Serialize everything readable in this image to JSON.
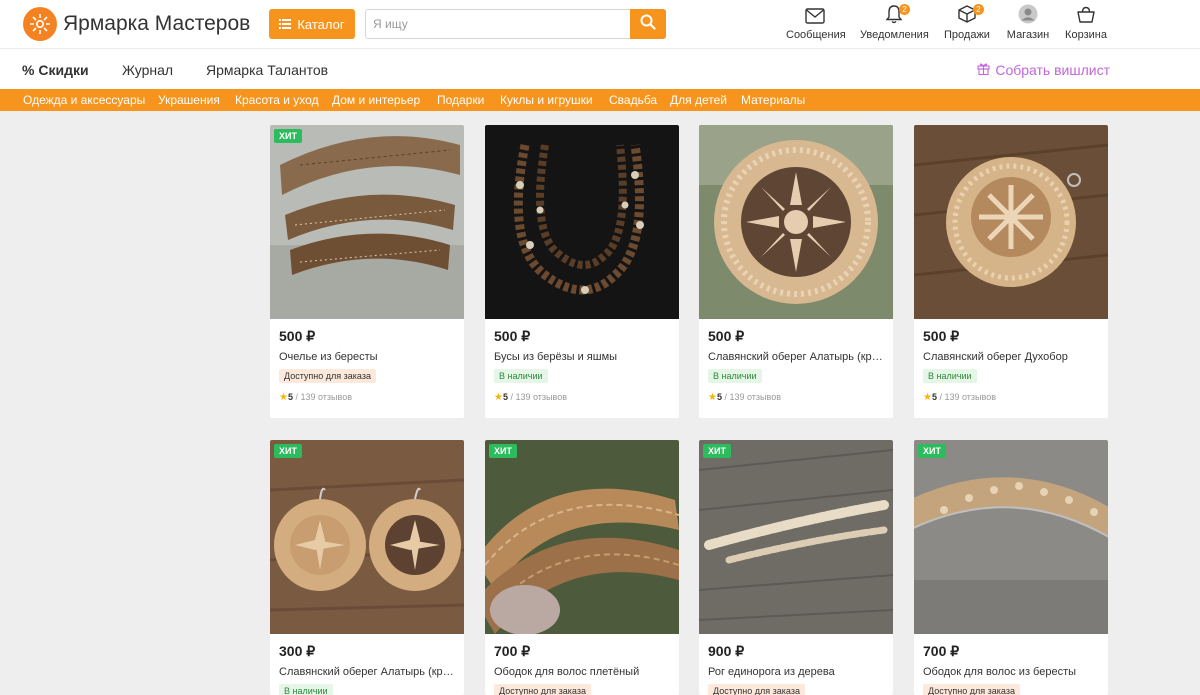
{
  "header": {
    "brand": "Ярмарка Мастеров",
    "catalog_label": "Каталог",
    "search_placeholder": "Я ищу",
    "nav": [
      {
        "label": "Сообщения",
        "icon": "envelope-icon",
        "badge": ""
      },
      {
        "label": "Уведомления",
        "icon": "bell-icon",
        "badge": "2"
      },
      {
        "label": "Продажи",
        "icon": "box-icon",
        "badge": "2"
      },
      {
        "label": "Магазин",
        "icon": "shop-avatar-icon",
        "badge": ""
      },
      {
        "label": "Корзина",
        "icon": "basket-icon",
        "badge": ""
      }
    ]
  },
  "subnav": {
    "discounts": "Скидки",
    "journal": "Журнал",
    "talents": "Ярмарка Талантов",
    "wishlist": "Собрать вишлист"
  },
  "categories": [
    "Одежда и аксессуары",
    "Украшения",
    "Красота и уход",
    "Дом и интерьер",
    "Подарки",
    "Куклы и игрушки",
    "Свадьба",
    "Для детей",
    "Материалы"
  ],
  "products": [
    {
      "price": "500 ₽",
      "title": "Очелье из бересты",
      "hit": "ХИТ",
      "status": "Доступно для заказа",
      "status_type": "order",
      "rating": "5",
      "reviews": " / 139 отзывов"
    },
    {
      "price": "500 ₽",
      "title": "Бусы из берёзы и яшмы",
      "hit": "",
      "status": "В наличии",
      "status_type": "stock",
      "rating": "5",
      "reviews": " / 139 отзывов"
    },
    {
      "price": "500 ₽",
      "title": "Славянский оберег Алатырь (крестик",
      "hit": "",
      "status": "В наличии",
      "status_type": "stock",
      "rating": "5",
      "reviews": " / 139 отзывов"
    },
    {
      "price": "500 ₽",
      "title": "Славянский оберег Духобор",
      "hit": "",
      "status": "В наличии",
      "status_type": "stock",
      "rating": "5",
      "reviews": " / 139 отзывов"
    },
    {
      "price": "300 ₽",
      "title": "Славянский оберег Алатырь (крестик",
      "hit": "ХИТ",
      "status": "В наличии",
      "status_type": "stock",
      "rating": "",
      "reviews": ""
    },
    {
      "price": "700 ₽",
      "title": "Ободок для волос плетёный",
      "hit": "ХИТ",
      "status": "Доступно для заказа",
      "status_type": "order",
      "rating": "",
      "reviews": ""
    },
    {
      "price": "900 ₽",
      "title": "Рог единорога из дерева",
      "hit": "ХИТ",
      "status": "Доступно для заказа",
      "status_type": "order",
      "rating": "",
      "reviews": ""
    },
    {
      "price": "700 ₽",
      "title": "Ободок для волос из бересты",
      "hit": "ХИТ",
      "status": "Доступно для заказа",
      "status_type": "order",
      "rating": "",
      "reviews": ""
    }
  ],
  "colors": {
    "accent": "#f7941d",
    "hit": "#2cbc5d",
    "wishlist": "#c266d8"
  }
}
